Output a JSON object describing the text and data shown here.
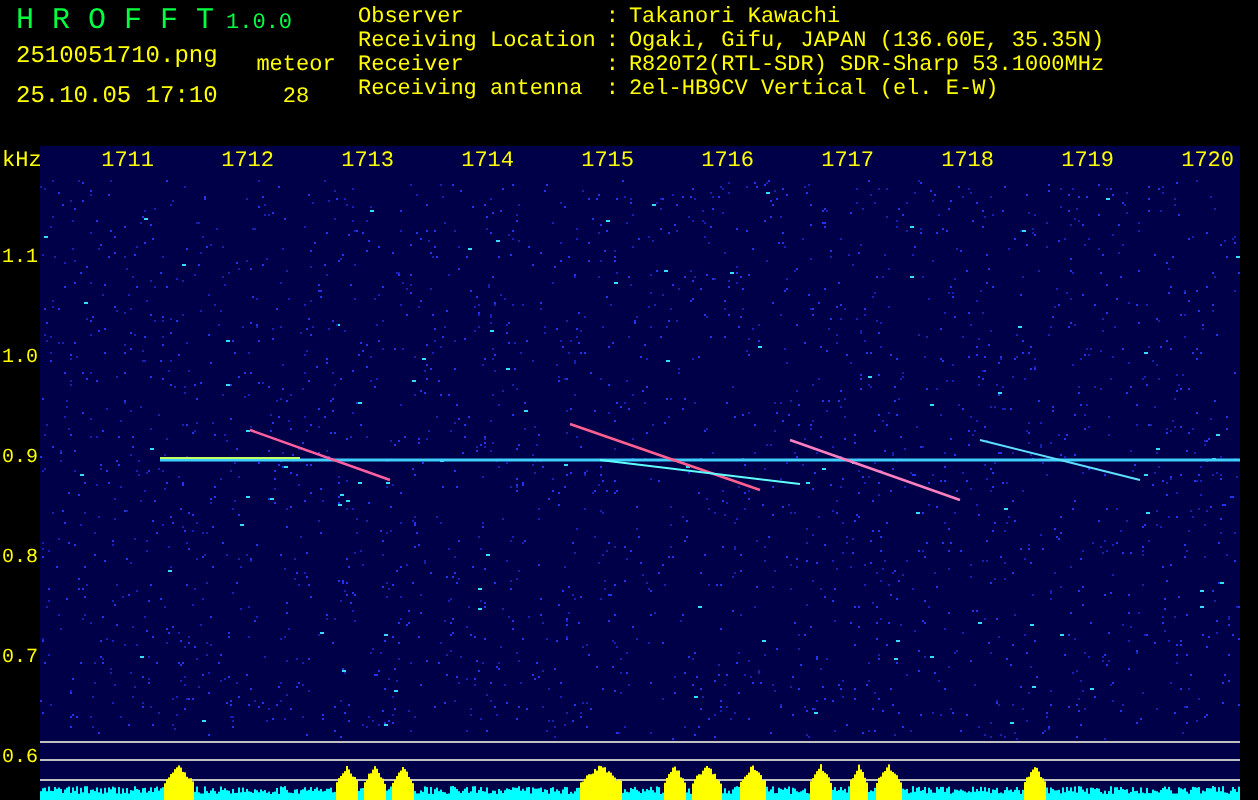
{
  "header": {
    "app_name": "H R O F F T",
    "version": "1.0.0",
    "filename": "2510051710.png",
    "datetime": "25.10.05 17:10",
    "meteor_label": "meteor",
    "meteor_count": "28"
  },
  "info": [
    {
      "label": "Observer",
      "value": "Takanori Kawachi"
    },
    {
      "label": "Receiving Location",
      "value": "Ogaki, Gifu, JAPAN (136.60E, 35.35N)"
    },
    {
      "label": "Receiver",
      "value": "R820T2(RTL-SDR) SDR-Sharp 53.1000MHz"
    },
    {
      "label": "Receiving antenna",
      "value": "2el-HB9CV Vertical (el. E-W)"
    }
  ],
  "separator": ":",
  "axis": {
    "unit": "kHz",
    "x_labels": [
      "1711",
      "1712",
      "1713",
      "1714",
      "1715",
      "1716",
      "1717",
      "1718",
      "1719",
      "1720"
    ],
    "y_labels": [
      "1.1",
      "1.0",
      "0.9",
      "0.8",
      "0.7",
      "0.6"
    ]
  }
}
